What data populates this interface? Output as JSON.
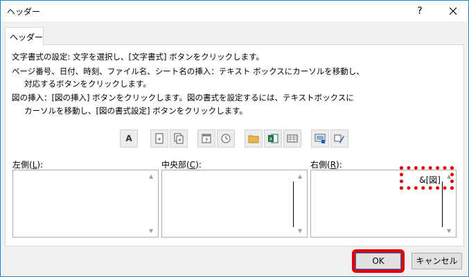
{
  "window": {
    "title": "ヘッダー",
    "help_label": "?"
  },
  "tab": {
    "label": "ヘッダー"
  },
  "instructions": [
    "文字書式の設定: 文字を選択し、[文字書式] ボタンをクリックします。",
    "ページ番号、日付、時刻、ファイル名、シート名の挿入：テキスト ボックスにカーソルを移動し、",
    "対応するボタンをクリックします。",
    "図の挿入：[図の挿入] ボタンをクリックします。図の書式を設定するには、テキストボックスに",
    "カーソルを移動し、[図の書式設定] ボタンをクリックします。"
  ],
  "toolbar": {
    "format_text_label": "A",
    "buttons": [
      "format-text",
      "insert-page-number",
      "insert-number-of-pages",
      "insert-date",
      "insert-time",
      "insert-file-path",
      "insert-file-name",
      "insert-sheet-name",
      "insert-picture",
      "format-picture"
    ]
  },
  "sections": {
    "left": {
      "label_pre": "左側(",
      "accel": "L",
      "label_post": "):",
      "value": ""
    },
    "center": {
      "label_pre": "中央部(",
      "accel": "C",
      "label_post": "):",
      "value": ""
    },
    "right": {
      "label_pre": "右側(",
      "accel": "R",
      "label_post": "):",
      "value": "&[図]"
    }
  },
  "buttons": {
    "ok": "OK",
    "cancel": "キャンセル"
  },
  "colors": {
    "highlight": "#e00000",
    "accent": "#0078d7"
  }
}
